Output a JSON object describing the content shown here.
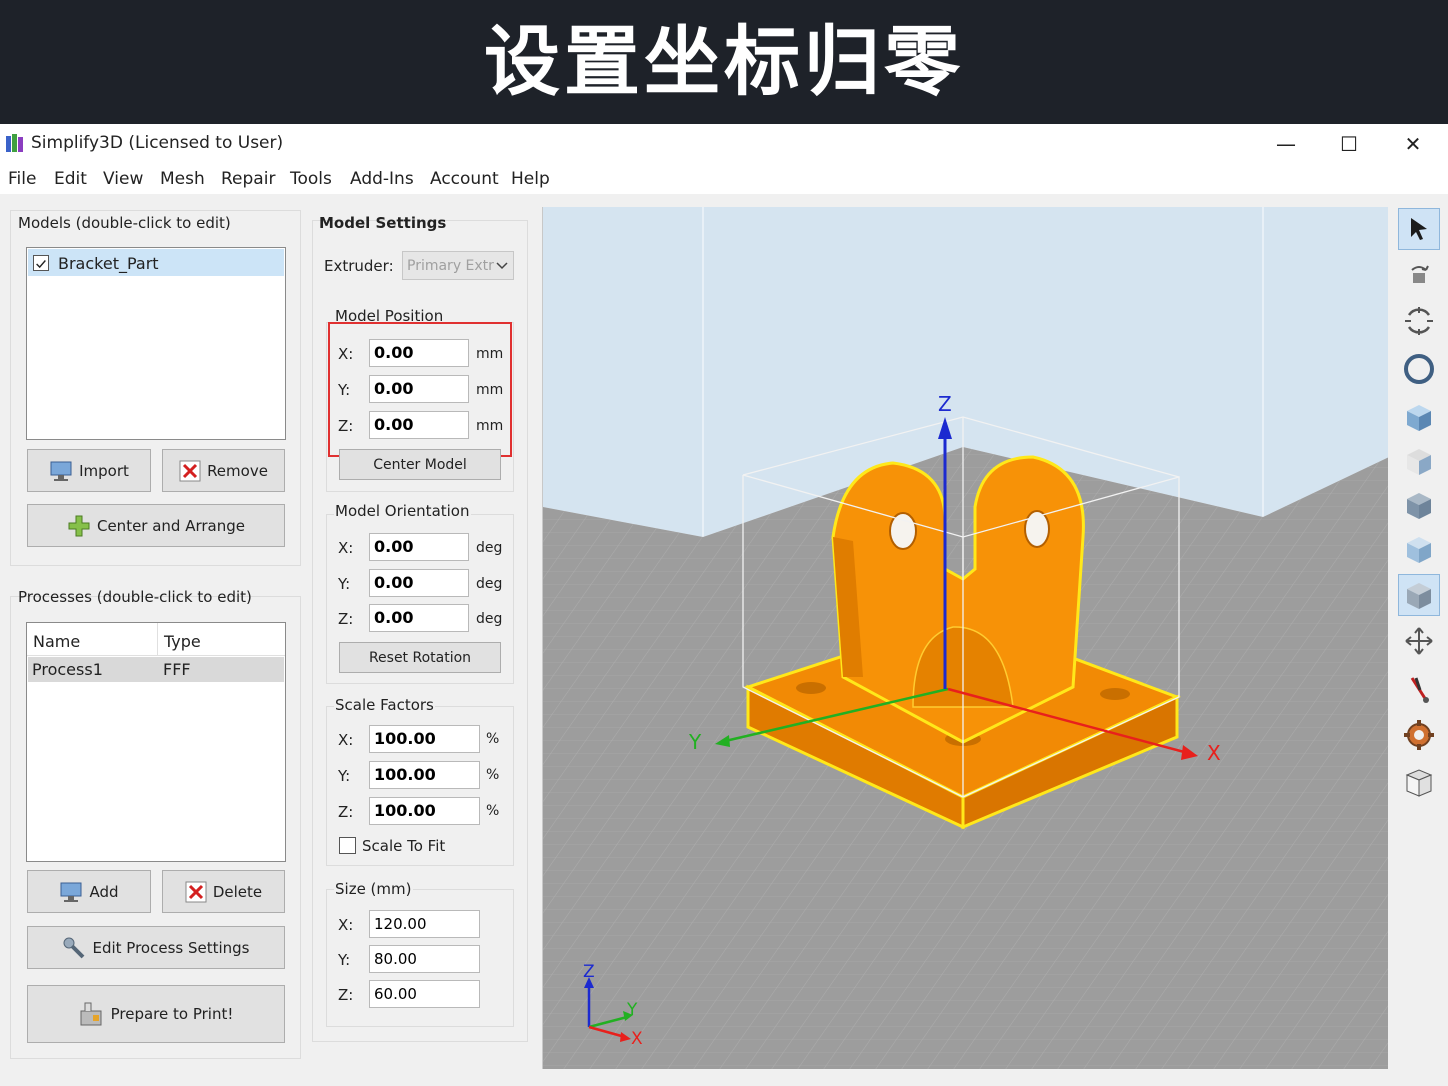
{
  "banner": {
    "text": "设置坐标归零"
  },
  "window": {
    "title": "Simplify3D (Licensed to User)",
    "minimize": "—",
    "maximize": "☐",
    "close": "✕"
  },
  "menu": [
    "File",
    "Edit",
    "View",
    "Mesh",
    "Repair",
    "Tools",
    "Add-Ins",
    "Account",
    "Help"
  ],
  "models": {
    "header": "Models (double-click to edit)",
    "items": [
      {
        "name": "Bracket_Part",
        "checked": true
      }
    ],
    "import_label": "Import",
    "remove_label": "Remove",
    "center_arrange_label": "Center and Arrange"
  },
  "processes": {
    "header": "Processes (double-click to edit)",
    "columns": [
      "Name",
      "Type"
    ],
    "rows": [
      {
        "name": "Process1",
        "type": "FFF"
      }
    ],
    "add_label": "Add",
    "delete_label": "Delete",
    "edit_label": "Edit Process Settings",
    "prepare_label": "Prepare to Print!"
  },
  "model_settings": {
    "header": "Model Settings",
    "extruder_label": "Extruder:",
    "extruder_value": "Primary Extruder",
    "position": {
      "header": "Model Position",
      "x_label": "X:",
      "y_label": "Y:",
      "z_label": "Z:",
      "x": "0.00",
      "y": "0.00",
      "z": "0.00",
      "unit": "mm",
      "center_label": "Center Model"
    },
    "orientation": {
      "header": "Model Orientation",
      "x_label": "X:",
      "y_label": "Y:",
      "z_label": "Z:",
      "x": "0.00",
      "y": "0.00",
      "z": "0.00",
      "unit": "deg",
      "reset_label": "Reset Rotation"
    },
    "scale": {
      "header": "Scale Factors",
      "x_label": "X:",
      "y_label": "Y:",
      "z_label": "Z:",
      "x": "100.00",
      "y": "100.00",
      "z": "100.00",
      "unit": "%",
      "fit_label": "Scale To Fit",
      "fit_checked": false
    },
    "size": {
      "header": "Size (mm)",
      "x_label": "X:",
      "y_label": "Y:",
      "z_label": "Z:",
      "x": "120.00",
      "y": "80.00",
      "z": "60.00"
    }
  },
  "viewport": {
    "axis_x": "X",
    "axis_y": "Y",
    "axis_z": "Z",
    "colors": {
      "model": "#ff9a0a",
      "outline": "#ffee00",
      "bed": "#9a9a9a",
      "sky": "#d4e3f0",
      "x_axis": "#e8201c",
      "y_axis": "#22b022",
      "z_axis": "#1c2ad0"
    }
  },
  "toolbar": [
    "select-icon",
    "move-icon",
    "rotate-icon",
    "orbit-icon",
    "view-default-icon",
    "view-front-icon",
    "view-back-icon",
    "view-left-icon",
    "view-right-icon",
    "translate-icon",
    "cut-icon",
    "gear-icon",
    "cube-outline-icon"
  ],
  "highlight_color": "#e03030"
}
